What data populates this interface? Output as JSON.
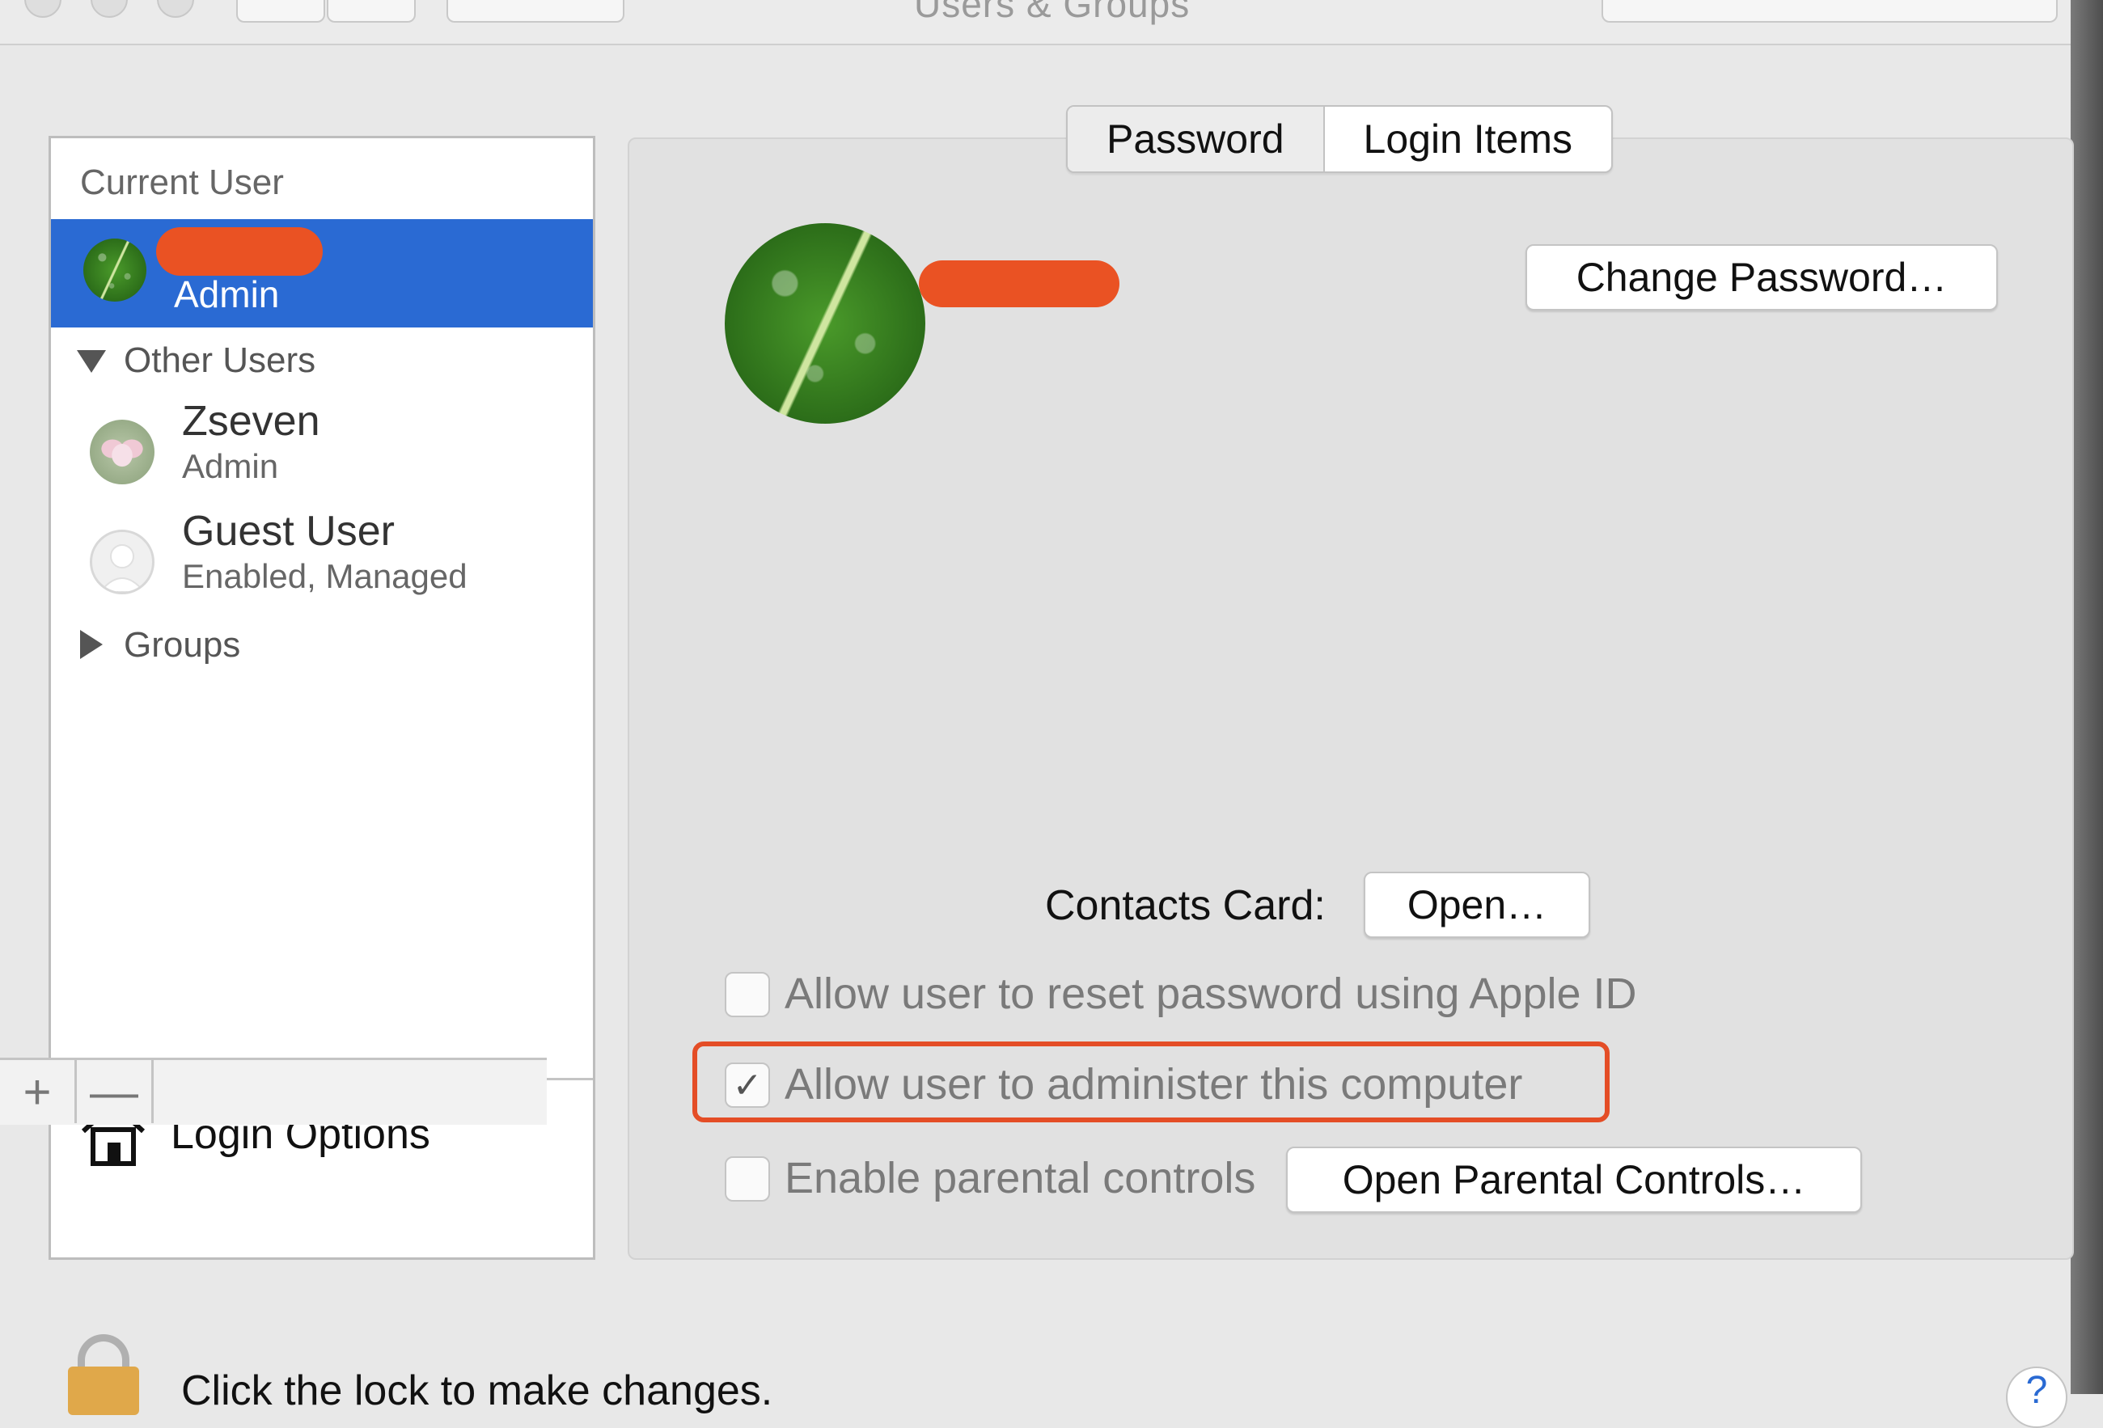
{
  "window": {
    "title": "Users & Groups"
  },
  "sidebar": {
    "current_user_header": "Current User",
    "current_user": {
      "name": "",
      "role": "Admin",
      "avatar": "leaf-icon"
    },
    "other_users_header": "Other Users",
    "other_users": [
      {
        "name": "Zseven",
        "role": "Admin",
        "avatar": "lotus-icon"
      },
      {
        "name": "Guest User",
        "role": "Enabled, Managed",
        "avatar": "guest-icon"
      }
    ],
    "groups_header": "Groups",
    "login_options_label": "Login Options",
    "add_label": "+",
    "remove_label": "—"
  },
  "tabs": {
    "password": "Password",
    "login_items": "Login Items",
    "active": "password"
  },
  "user_panel": {
    "change_password_button": "Change Password…",
    "contacts_card_label": "Contacts Card:",
    "open_button": "Open…",
    "allow_reset_apple_id": {
      "label": "Allow user to reset password using Apple ID",
      "checked": false
    },
    "allow_administer": {
      "label": "Allow user to administer this computer",
      "checked": true
    },
    "enable_parental_controls": {
      "label": "Enable parental controls",
      "checked": false
    },
    "open_parental_controls_button": "Open Parental Controls…"
  },
  "footer": {
    "lock_text": "Click the lock to make changes.",
    "help_label": "?"
  },
  "colors": {
    "selection_blue": "#2a6ad3",
    "highlight_red": "#e44d26",
    "redaction": "#ea5223"
  }
}
